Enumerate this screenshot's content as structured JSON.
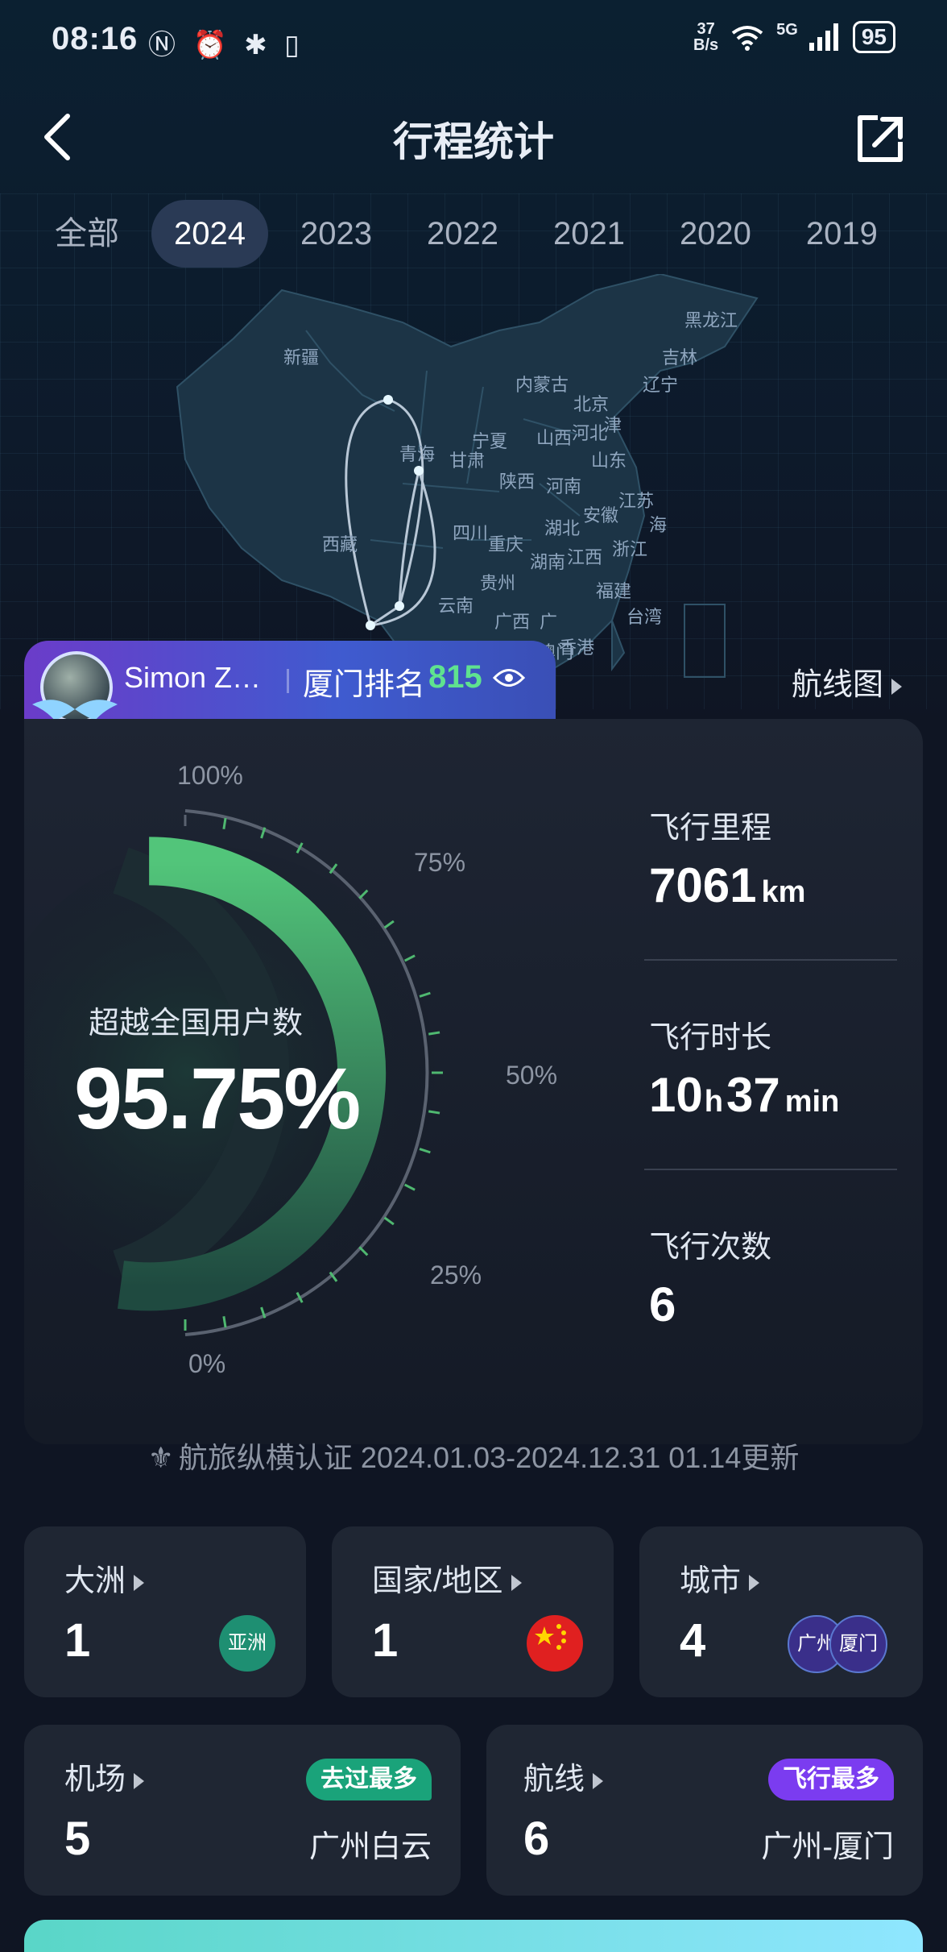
{
  "status": {
    "time": "08:16",
    "net_speed_top": "37",
    "net_speed_bottom": "B/s",
    "network": "5G",
    "battery": "95"
  },
  "header": {
    "title": "行程统计"
  },
  "tabs": [
    "全部",
    "2024",
    "2023",
    "2022",
    "2021",
    "2020",
    "2019"
  ],
  "active_tab": "2024",
  "map_labels": {
    "xinjiang": "新疆",
    "xizang": "西藏",
    "qinghai": "青海",
    "gansu": "甘肃",
    "neimenggu": "内蒙古",
    "heilongjiang": "黑龙江",
    "jilin": "吉林",
    "liaoning": "辽宁",
    "beijing": "北京",
    "tianjin": "津",
    "hebei": "河北",
    "shanxi": "山西",
    "ningxia": "宁夏",
    "shaanxi": "陕西",
    "henan": "河南",
    "shandong": "山东",
    "jiangsu": "江苏",
    "shanghai": "海",
    "anhui": "安徽",
    "hubei": "湖北",
    "sichuan": "四川",
    "chongqing": "重庆",
    "zhejiang": "浙江",
    "jiangxi": "江西",
    "hunan": "湖南",
    "guizhou": "贵州",
    "yunnan": "云南",
    "guangxi": "广西",
    "guangdong": "广",
    "fujian": "福建",
    "taiwan": "台湾",
    "hongkong": "香港",
    "macau": "澳门"
  },
  "user": {
    "name": "Simon Z…",
    "rank_label": "厦门排名",
    "rank_value": "815",
    "route_map_link": "航线图"
  },
  "gauge": {
    "exceed_label": "超越全国用户数",
    "exceed_value": "95.75%",
    "percent": 95.75,
    "ticks": [
      "100%",
      "75%",
      "50%",
      "25%",
      "0%"
    ]
  },
  "stats": {
    "mileage": {
      "label": "飞行里程",
      "value": "7061",
      "unit": "km"
    },
    "duration": {
      "label": "飞行时长",
      "hours": "10",
      "hours_unit": "h",
      "minutes": "37",
      "minutes_unit": "min"
    },
    "count": {
      "label": "飞行次数",
      "value": "6"
    }
  },
  "certification": "航旅纵横认证 2024.01.03-2024.12.31 01.14更新",
  "cards": {
    "continent": {
      "label": "大洲",
      "value": "1",
      "badge": "亚洲"
    },
    "country": {
      "label": "国家/地区",
      "value": "1"
    },
    "city": {
      "label": "城市",
      "value": "4",
      "badges": [
        "广州",
        "厦门"
      ]
    },
    "airport": {
      "label": "机场",
      "value": "5",
      "tag": "去过最多",
      "top": "广州白云"
    },
    "route": {
      "label": "航线",
      "value": "6",
      "tag": "飞行最多",
      "top": "广州-厦门"
    }
  },
  "colors": {
    "accent_green": "#5fe28f",
    "tag_teal": "#1aa37a",
    "tag_purple": "#7b3cf0",
    "card_bg": "#1f2633"
  }
}
